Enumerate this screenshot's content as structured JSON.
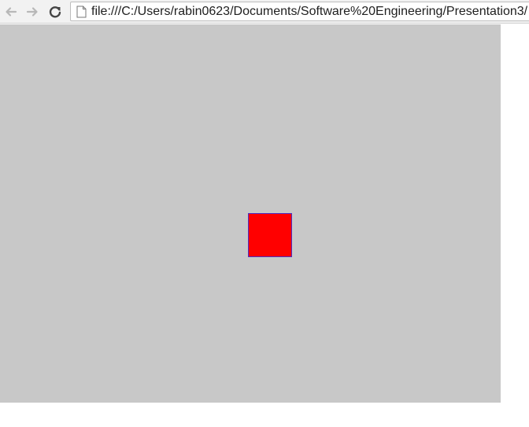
{
  "browser": {
    "address_bar": {
      "url": "file:///C:/Users/rabin0623/Documents/Software%20Engineering/Presentation3/"
    },
    "icons": {
      "back": "back-arrow-icon",
      "forward": "forward-arrow-icon",
      "reload": "reload-icon",
      "page": "page-icon"
    }
  },
  "page": {
    "canvas_color": "#c8c8c8",
    "square": {
      "fill": "#ff0000",
      "stroke": "#4a2fc4"
    }
  }
}
